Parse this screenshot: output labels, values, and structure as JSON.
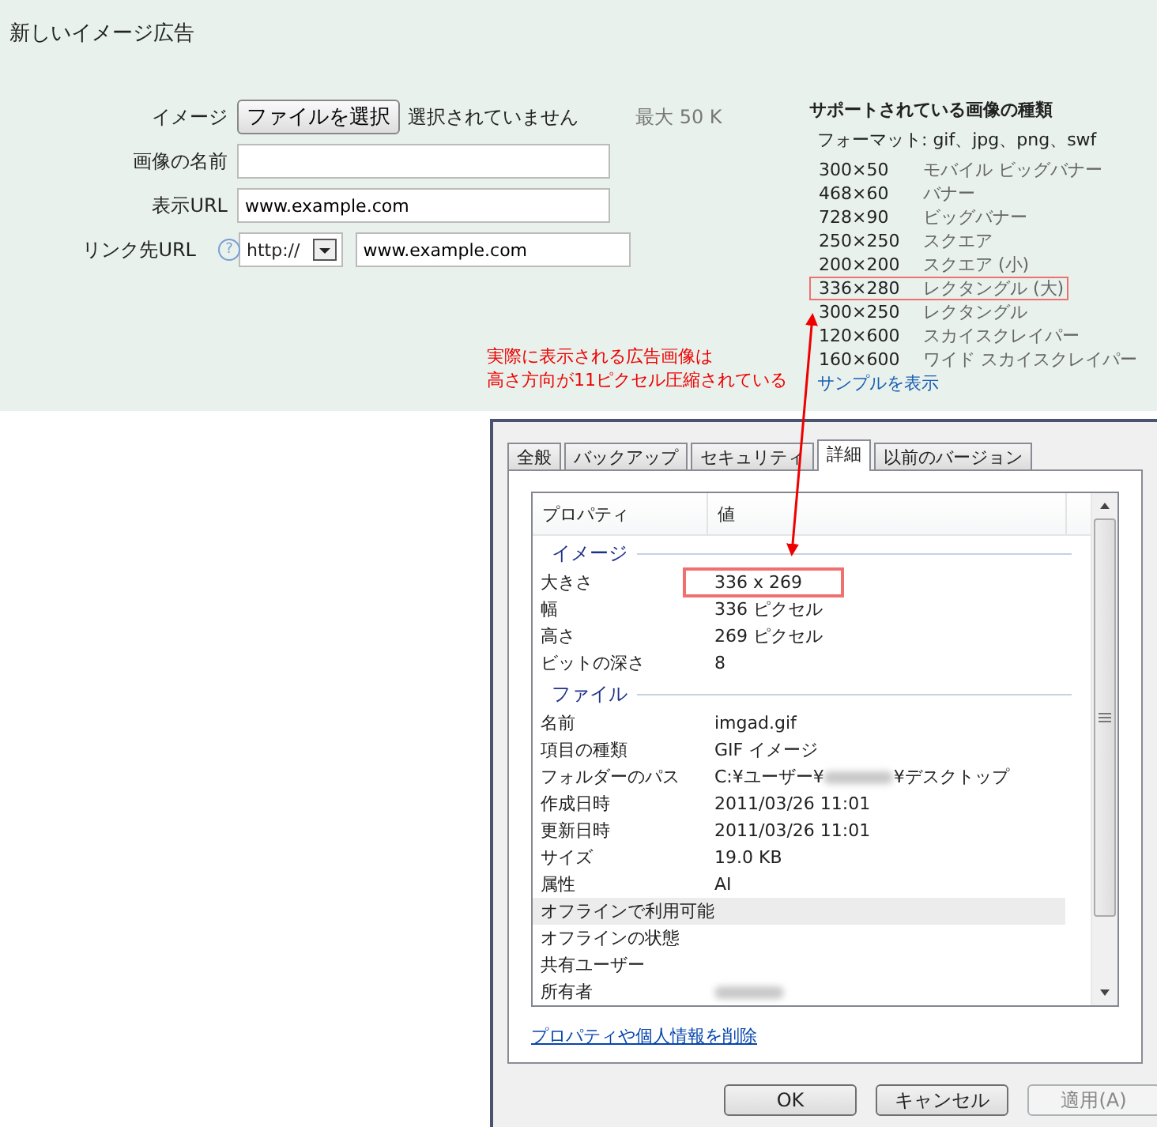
{
  "page_title": "新しいイメージ広告",
  "form": {
    "image": {
      "label": "イメージ",
      "button": "ファイルを選択",
      "status": "選択されていません",
      "limit": "最大 50 K"
    },
    "fields": [
      {
        "kind": "text",
        "label": "画像の名前"
      },
      {
        "kind": "text",
        "label": "表示URL",
        "value": "www.example.com"
      },
      {
        "kind": "url",
        "label": "リンク先URL",
        "help": "?",
        "protocol": "http://",
        "value": "www.example.com"
      }
    ]
  },
  "annotation": {
    "lines": [
      "実際に表示される広告画像は",
      "高さ方向が11ピクセル圧縮されている"
    ]
  },
  "supported": {
    "title": "サポートされている画像の種類",
    "formats": "フォーマット: gif、jpg、png、swf",
    "sizes": [
      {
        "size": "300×50",
        "name": "モバイル ビッグバナー",
        "boxed": false
      },
      {
        "size": "468×60",
        "name": "バナー",
        "boxed": false
      },
      {
        "size": "728×90",
        "name": "ビッグバナー",
        "boxed": false
      },
      {
        "size": "250×250",
        "name": "スクエア",
        "boxed": false
      },
      {
        "size": "200×200",
        "name": "スクエア (小)",
        "boxed": false
      },
      {
        "size": "336×280",
        "name": "レクタングル (大)",
        "boxed": true
      },
      {
        "size": "300×250",
        "name": "レクタングル",
        "boxed": false
      },
      {
        "size": "120×600",
        "name": "スカイスクレイパー",
        "boxed": false
      },
      {
        "size": "160×600",
        "name": "ワイド スカイスクレイパー",
        "boxed": false
      }
    ],
    "sample_link": "サンプルを表示"
  },
  "dialog": {
    "tabs": [
      {
        "label": "全般",
        "selected": false
      },
      {
        "label": "バックアップ",
        "selected": false
      },
      {
        "label": "セキュリティ",
        "selected": false
      },
      {
        "label": "詳細",
        "selected": true
      },
      {
        "label": "以前のバージョン",
        "selected": false
      }
    ],
    "columns": [
      "プロパティ",
      "値"
    ],
    "groups": [
      {
        "title": "イメージ",
        "rows": [
          {
            "property": "大きさ",
            "value": "336 x 269",
            "boxed": true,
            "hovered": false,
            "blurred": false
          },
          {
            "property": "幅",
            "value": "336 ピクセル",
            "boxed": false,
            "hovered": false,
            "blurred": false
          },
          {
            "property": "高さ",
            "value": "269 ピクセル",
            "boxed": false,
            "hovered": false,
            "blurred": false
          },
          {
            "property": "ビットの深さ",
            "value": "8",
            "boxed": false,
            "hovered": false,
            "blurred": false
          }
        ]
      },
      {
        "title": "ファイル",
        "rows": [
          {
            "property": "名前",
            "value": "imgad.gif",
            "boxed": false,
            "hovered": false,
            "blurred": false
          },
          {
            "property": "項目の種類",
            "value": "GIF イメージ",
            "boxed": false,
            "hovered": false,
            "blurred": false
          },
          {
            "property": "フォルダーのパス",
            "value": "C:¥ユーザー¥",
            "value_after_blur": "¥デスクトップ",
            "boxed": false,
            "hovered": false,
            "blurred": true
          },
          {
            "property": "作成日時",
            "value": "2011/03/26 11:01",
            "boxed": false,
            "hovered": false,
            "blurred": false
          },
          {
            "property": "更新日時",
            "value": "2011/03/26 11:01",
            "boxed": false,
            "hovered": false,
            "blurred": false
          },
          {
            "property": "サイズ",
            "value": "19.0 KB",
            "boxed": false,
            "hovered": false,
            "blurred": false
          },
          {
            "property": "属性",
            "value": "AI",
            "boxed": false,
            "hovered": false,
            "blurred": false
          },
          {
            "property": "オフラインで利用可能",
            "boxed": false,
            "hovered": true,
            "blurred": false
          },
          {
            "property": "オフラインの状態",
            "boxed": false,
            "hovered": false,
            "blurred": false
          },
          {
            "property": "共有ユーザー",
            "boxed": false,
            "hovered": false,
            "blurred": false
          },
          {
            "property": "所有者",
            "boxed": false,
            "hovered": false,
            "blurred": true
          }
        ]
      }
    ],
    "link": "プロパティや個人情報を削除",
    "buttons": [
      {
        "label": "OK",
        "disabled": false
      },
      {
        "label": "キャンセル",
        "disabled": false
      },
      {
        "label": "適用(A)",
        "disabled": true
      }
    ]
  }
}
